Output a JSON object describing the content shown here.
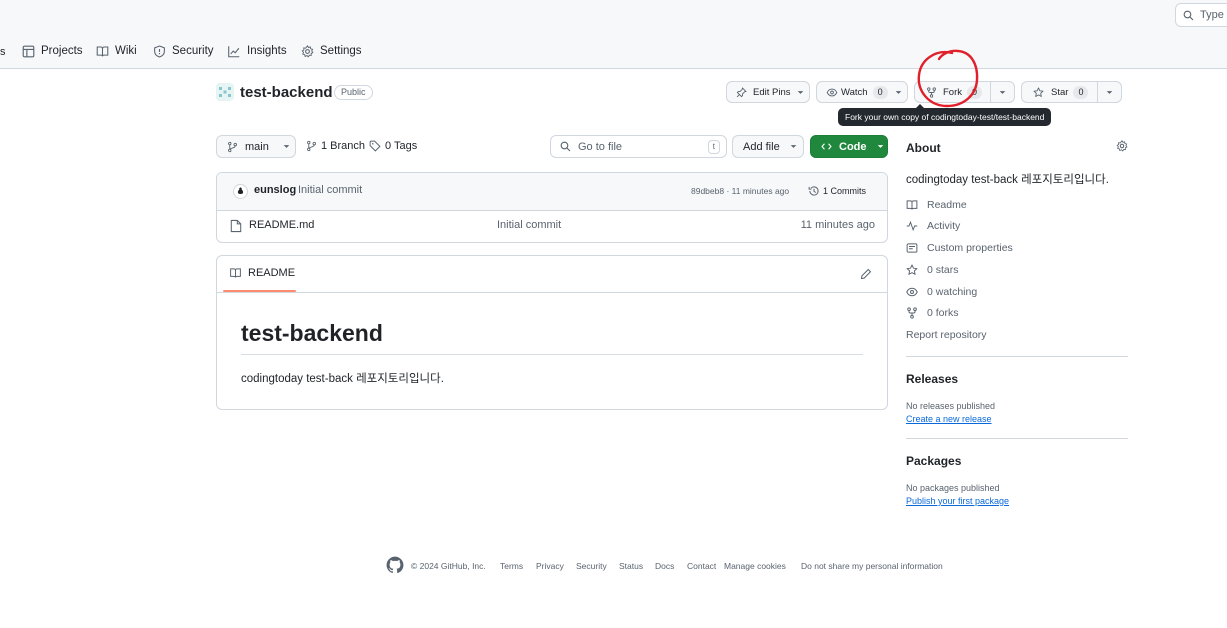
{
  "header": {
    "search_placeholder": "Type [",
    "nav": [
      {
        "label": "Projects",
        "icon": "table-icon"
      },
      {
        "label": "Wiki",
        "icon": "book-icon"
      },
      {
        "label": "Security",
        "icon": "shield-icon"
      },
      {
        "label": "Insights",
        "icon": "graph-icon"
      },
      {
        "label": "Settings",
        "icon": "gear-icon"
      }
    ]
  },
  "repo": {
    "name": "test-backend",
    "visibility": "Public",
    "edit_pins_label": "Edit Pins",
    "watch_label": "Watch",
    "watch_count": "0",
    "fork_label": "Fork",
    "fork_count": "0",
    "star_label": "Star",
    "star_count": "0",
    "fork_tooltip": "Fork your own copy of codingtoday-test/test-backend"
  },
  "toolbar": {
    "branch": "main",
    "branches": "1 Branch",
    "tags": "0 Tags",
    "goto_placeholder": "Go to file",
    "goto_shortcut": "t",
    "add_file_label": "Add file",
    "code_label": "Code"
  },
  "commit": {
    "author": "eunslog",
    "message": "Initial commit",
    "hash_time": "89dbeb8 · 11 minutes ago",
    "commits_label": "1 Commits"
  },
  "files": [
    {
      "name": "README.md",
      "message": "Initial commit",
      "time": "11 minutes ago"
    }
  ],
  "readme": {
    "tab_label": "README",
    "heading": "test-backend",
    "body": "codingtoday test-back 레포지토리입니다."
  },
  "about": {
    "title": "About",
    "description": "codingtoday test-back 레포지토리입니다.",
    "items": [
      {
        "label": "Readme",
        "icon": "book-icon"
      },
      {
        "label": "Activity",
        "icon": "pulse-icon"
      },
      {
        "label": "Custom properties",
        "icon": "note-icon"
      },
      {
        "label": "0 stars",
        "icon": "star-icon"
      },
      {
        "label": "0 watching",
        "icon": "eye-icon"
      },
      {
        "label": "0 forks",
        "icon": "fork-icon"
      }
    ],
    "report_label": "Report repository"
  },
  "releases": {
    "title": "Releases",
    "empty_text": "No releases published",
    "link": "Create a new release"
  },
  "packages": {
    "title": "Packages",
    "empty_text": "No packages published",
    "link": "Publish your first package"
  },
  "footer": {
    "copyright": "© 2024 GitHub, Inc.",
    "links": [
      "Terms",
      "Privacy",
      "Security",
      "Status",
      "Docs",
      "Contact",
      "Manage cookies",
      "Do not share my personal information"
    ]
  },
  "colors": {
    "accent_green": "#1f883d",
    "tab_underline": "#fd8c73",
    "link_blue": "#0969da",
    "annotation_red": "#e0202a"
  }
}
